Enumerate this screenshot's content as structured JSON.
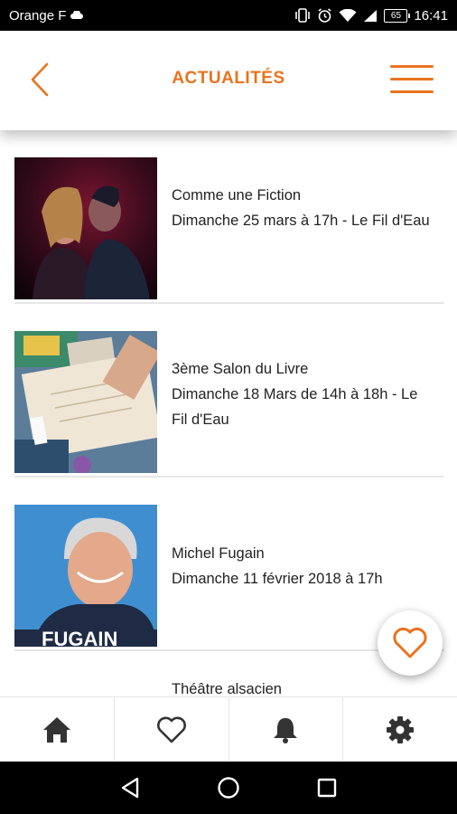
{
  "status_bar": {
    "carrier": "Orange F",
    "battery": "65",
    "time": "16:41"
  },
  "header": {
    "title": "ACTUALITÉS",
    "accent_color": "#e8731e"
  },
  "news": [
    {
      "title": "Comme une Fiction",
      "date": "Dimanche 25 mars à 17h - Le Fil d'Eau",
      "image": "two-performers-photo"
    },
    {
      "title": "3ème Salon du Livre",
      "date": "Dimanche 18 Mars de 14h à 18h - Le Fil d'Eau",
      "image": "book-signing-photo"
    },
    {
      "title": "Michel Fugain",
      "date": "Dimanche 11 février 2018 à 17h",
      "image": "singer-portrait-photo",
      "image_caption": "FUGAIN"
    },
    {
      "title": "Théâtre alsacien",
      "date": "",
      "image": ""
    }
  ],
  "fab": {
    "icon": "heart-outline-icon",
    "color": "#e8731e"
  },
  "bottom_nav": [
    {
      "name": "home",
      "icon": "home-icon"
    },
    {
      "name": "favorites",
      "icon": "heart-icon"
    },
    {
      "name": "notifications",
      "icon": "bell-icon"
    },
    {
      "name": "settings",
      "icon": "gear-icon"
    }
  ],
  "system_nav": [
    {
      "name": "back",
      "icon": "triangle-back-icon"
    },
    {
      "name": "home",
      "icon": "circle-home-icon"
    },
    {
      "name": "recents",
      "icon": "square-recents-icon"
    }
  ]
}
